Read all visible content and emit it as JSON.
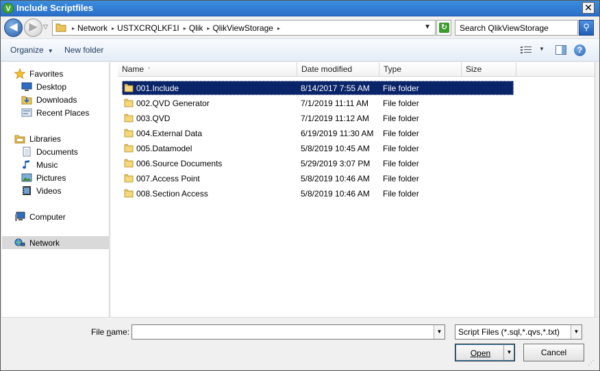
{
  "window": {
    "title": "Include Scriptfiles",
    "close_glyph": "✕",
    "app_icon_letter": "V"
  },
  "address": {
    "back_glyph": "◀",
    "forward_glyph": "▶",
    "history_glyph": "▽",
    "breadcrumb": [
      "Network",
      "USTXCRQLKF1I",
      "Qlik",
      "QlikViewStorage"
    ],
    "separator_glyph": "▸",
    "dropdown_glyph": "▼",
    "refresh_glyph": "↻",
    "search_placeholder": "Search QlikViewStorage",
    "search_glyph": "⚲"
  },
  "toolbar": {
    "organize_label": "Organize",
    "organize_caret": "▼",
    "new_folder_label": "New folder",
    "view_caret": "▼",
    "help_glyph": "?"
  },
  "nav": {
    "favorites": "Favorites",
    "desktop": "Desktop",
    "downloads": "Downloads",
    "recent_places": "Recent Places",
    "libraries": "Libraries",
    "documents": "Documents",
    "music": "Music",
    "pictures": "Pictures",
    "videos": "Videos",
    "computer": "Computer",
    "network": "Network"
  },
  "columns": {
    "name": "Name",
    "sort_glyph": "^",
    "date": "Date modified",
    "type": "Type",
    "size": "Size"
  },
  "files": [
    {
      "name": "001.Include",
      "date": "8/14/2017 7:55 AM",
      "type": "File folder"
    },
    {
      "name": "002.QVD Generator",
      "date": "7/1/2019 11:11 AM",
      "type": "File folder"
    },
    {
      "name": "003.QVD",
      "date": "7/1/2019 11:12 AM",
      "type": "File folder"
    },
    {
      "name": "004.External Data",
      "date": "6/19/2019 11:30 AM",
      "type": "File folder"
    },
    {
      "name": "005.Datamodel",
      "date": "5/8/2019 10:45 AM",
      "type": "File folder"
    },
    {
      "name": "006.Source Documents",
      "date": "5/29/2019 3:07 PM",
      "type": "File folder"
    },
    {
      "name": "007.Access Point",
      "date": "5/8/2019 10:46 AM",
      "type": "File folder"
    },
    {
      "name": "008.Section Access",
      "date": "5/8/2019 10:46 AM",
      "type": "File folder"
    }
  ],
  "bottom": {
    "file_name_label": "File name:",
    "file_name_value": "",
    "dropdown_glyph": "▼",
    "filter_value": "Script Files (*.sql,*.qvs,*.txt)",
    "open_label": "Open",
    "cancel_label": "Cancel",
    "grip_glyph": "⋰"
  },
  "colors": {
    "selection": "#0a246a",
    "titlebar": "#2a6fc9",
    "folder": "#e8c45a"
  }
}
